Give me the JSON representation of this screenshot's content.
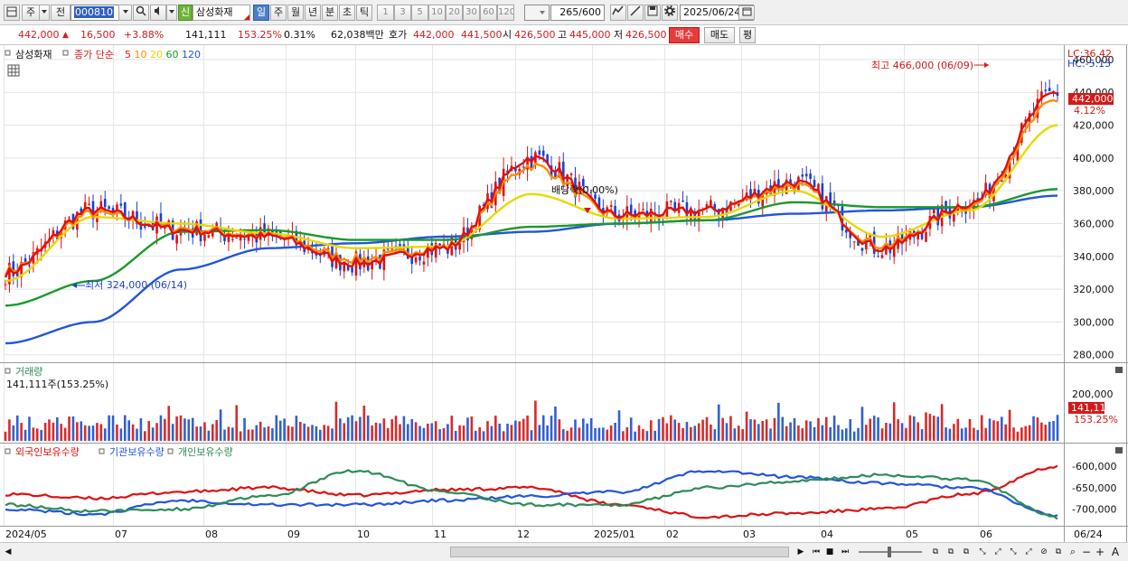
{
  "toolbar": {
    "period_main": "주",
    "prev_label": "전",
    "stock_code": "000810",
    "credit_badge": "신",
    "stock_name": "삼성화재",
    "periods": [
      "일",
      "주",
      "월",
      "년",
      "분",
      "초",
      "틱"
    ],
    "active_period": "일",
    "intervals": [
      "1",
      "3",
      "5",
      "10",
      "20",
      "30",
      "60",
      "120"
    ],
    "count_value": "265",
    "count_total": "/600",
    "date": "2025/06/24"
  },
  "quote": {
    "price": "442,000",
    "change": "16,500",
    "change_pct": "+3.88%",
    "volume": "141,111",
    "volume_ratio": "153.25%",
    "turnover": "0.31%",
    "amount": "62,038백만",
    "ask_label": "호가",
    "ask1": "442,000",
    "ask2": "441,500",
    "open_label": "시",
    "open": "426,500",
    "high_label": "고",
    "high": "445,000",
    "low_label": "저",
    "low": "426,500",
    "buy_label": "매수",
    "sell_label": "매도",
    "eval_label": "평"
  },
  "price_panel": {
    "stock_label": "삼성화재",
    "legend_prefix": "종가 단순",
    "ma_labels": [
      "5",
      "10",
      "20",
      "60",
      "120"
    ],
    "ma_colors": [
      "#e01010",
      "#ff8c00",
      "#e8d800",
      "#1a9a2a",
      "#2255dd"
    ],
    "lc": "LC:36.42",
    "hc": "HC:-5.15",
    "current_price": "442,000",
    "current_pct": "4.12%",
    "y_ticks": [
      "460,000",
      "440,000",
      "420,000",
      "400,000",
      "380,000",
      "360,000",
      "340,000",
      "320,000",
      "300,000",
      "280,000"
    ],
    "high_note": "최고 466,000 (06/09)",
    "low_note": "최저 324,000 (06/14)",
    "dividend_note": "배당락(0.00%)"
  },
  "volume_panel": {
    "title": "거래량",
    "subtitle": "141,111주(153.25%)",
    "y_tick": "200,000",
    "current": "141,111",
    "current_pct": "153.25%"
  },
  "holding_panel": {
    "series": [
      "외국인보유수량",
      "기관보유수량",
      "개인보유수량"
    ],
    "series_colors": [
      "#e01010",
      "#2255dd",
      "#2e8b57"
    ],
    "y_ticks": [
      "-600,000",
      "-650,000",
      "-700,000"
    ]
  },
  "x_axis": {
    "labels": [
      "2024/05",
      "07",
      "08",
      "09",
      "10",
      "11",
      "12",
      "2025/01",
      "02",
      "03",
      "04",
      "05",
      "06"
    ],
    "right_label": "06/24"
  },
  "chart_data": {
    "type": "line",
    "title": "",
    "xlabel": "",
    "ylabel": "",
    "ylim": [
      280000,
      466000
    ],
    "x": [
      "2024/05",
      "07",
      "08",
      "09",
      "10",
      "11",
      "12",
      "2025/01",
      "02",
      "03",
      "04",
      "05",
      "06"
    ],
    "series": [
      {
        "name": "5",
        "values": [
          330000,
          368000,
          356000,
          352000,
          336000,
          345000,
          400000,
          365000,
          368000,
          385000,
          345000,
          372000,
          440000
        ]
      },
      {
        "name": "10",
        "values": [
          332000,
          365000,
          358000,
          353000,
          340000,
          346000,
          392000,
          364000,
          368000,
          382000,
          348000,
          370000,
          432000
        ]
      },
      {
        "name": "20",
        "values": [
          325000,
          364000,
          360000,
          354000,
          345000,
          346000,
          378000,
          363000,
          364000,
          380000,
          352000,
          368000,
          420000
        ]
      },
      {
        "name": "60",
        "values": [
          310000,
          325000,
          355000,
          356000,
          350000,
          350000,
          358000,
          360000,
          362000,
          373000,
          370000,
          370000,
          381000
        ]
      },
      {
        "name": "120",
        "values": [
          287000,
          300000,
          332000,
          345000,
          348000,
          352000,
          355000,
          360000,
          362000,
          366000,
          368000,
          370000,
          377000
        ]
      }
    ]
  }
}
